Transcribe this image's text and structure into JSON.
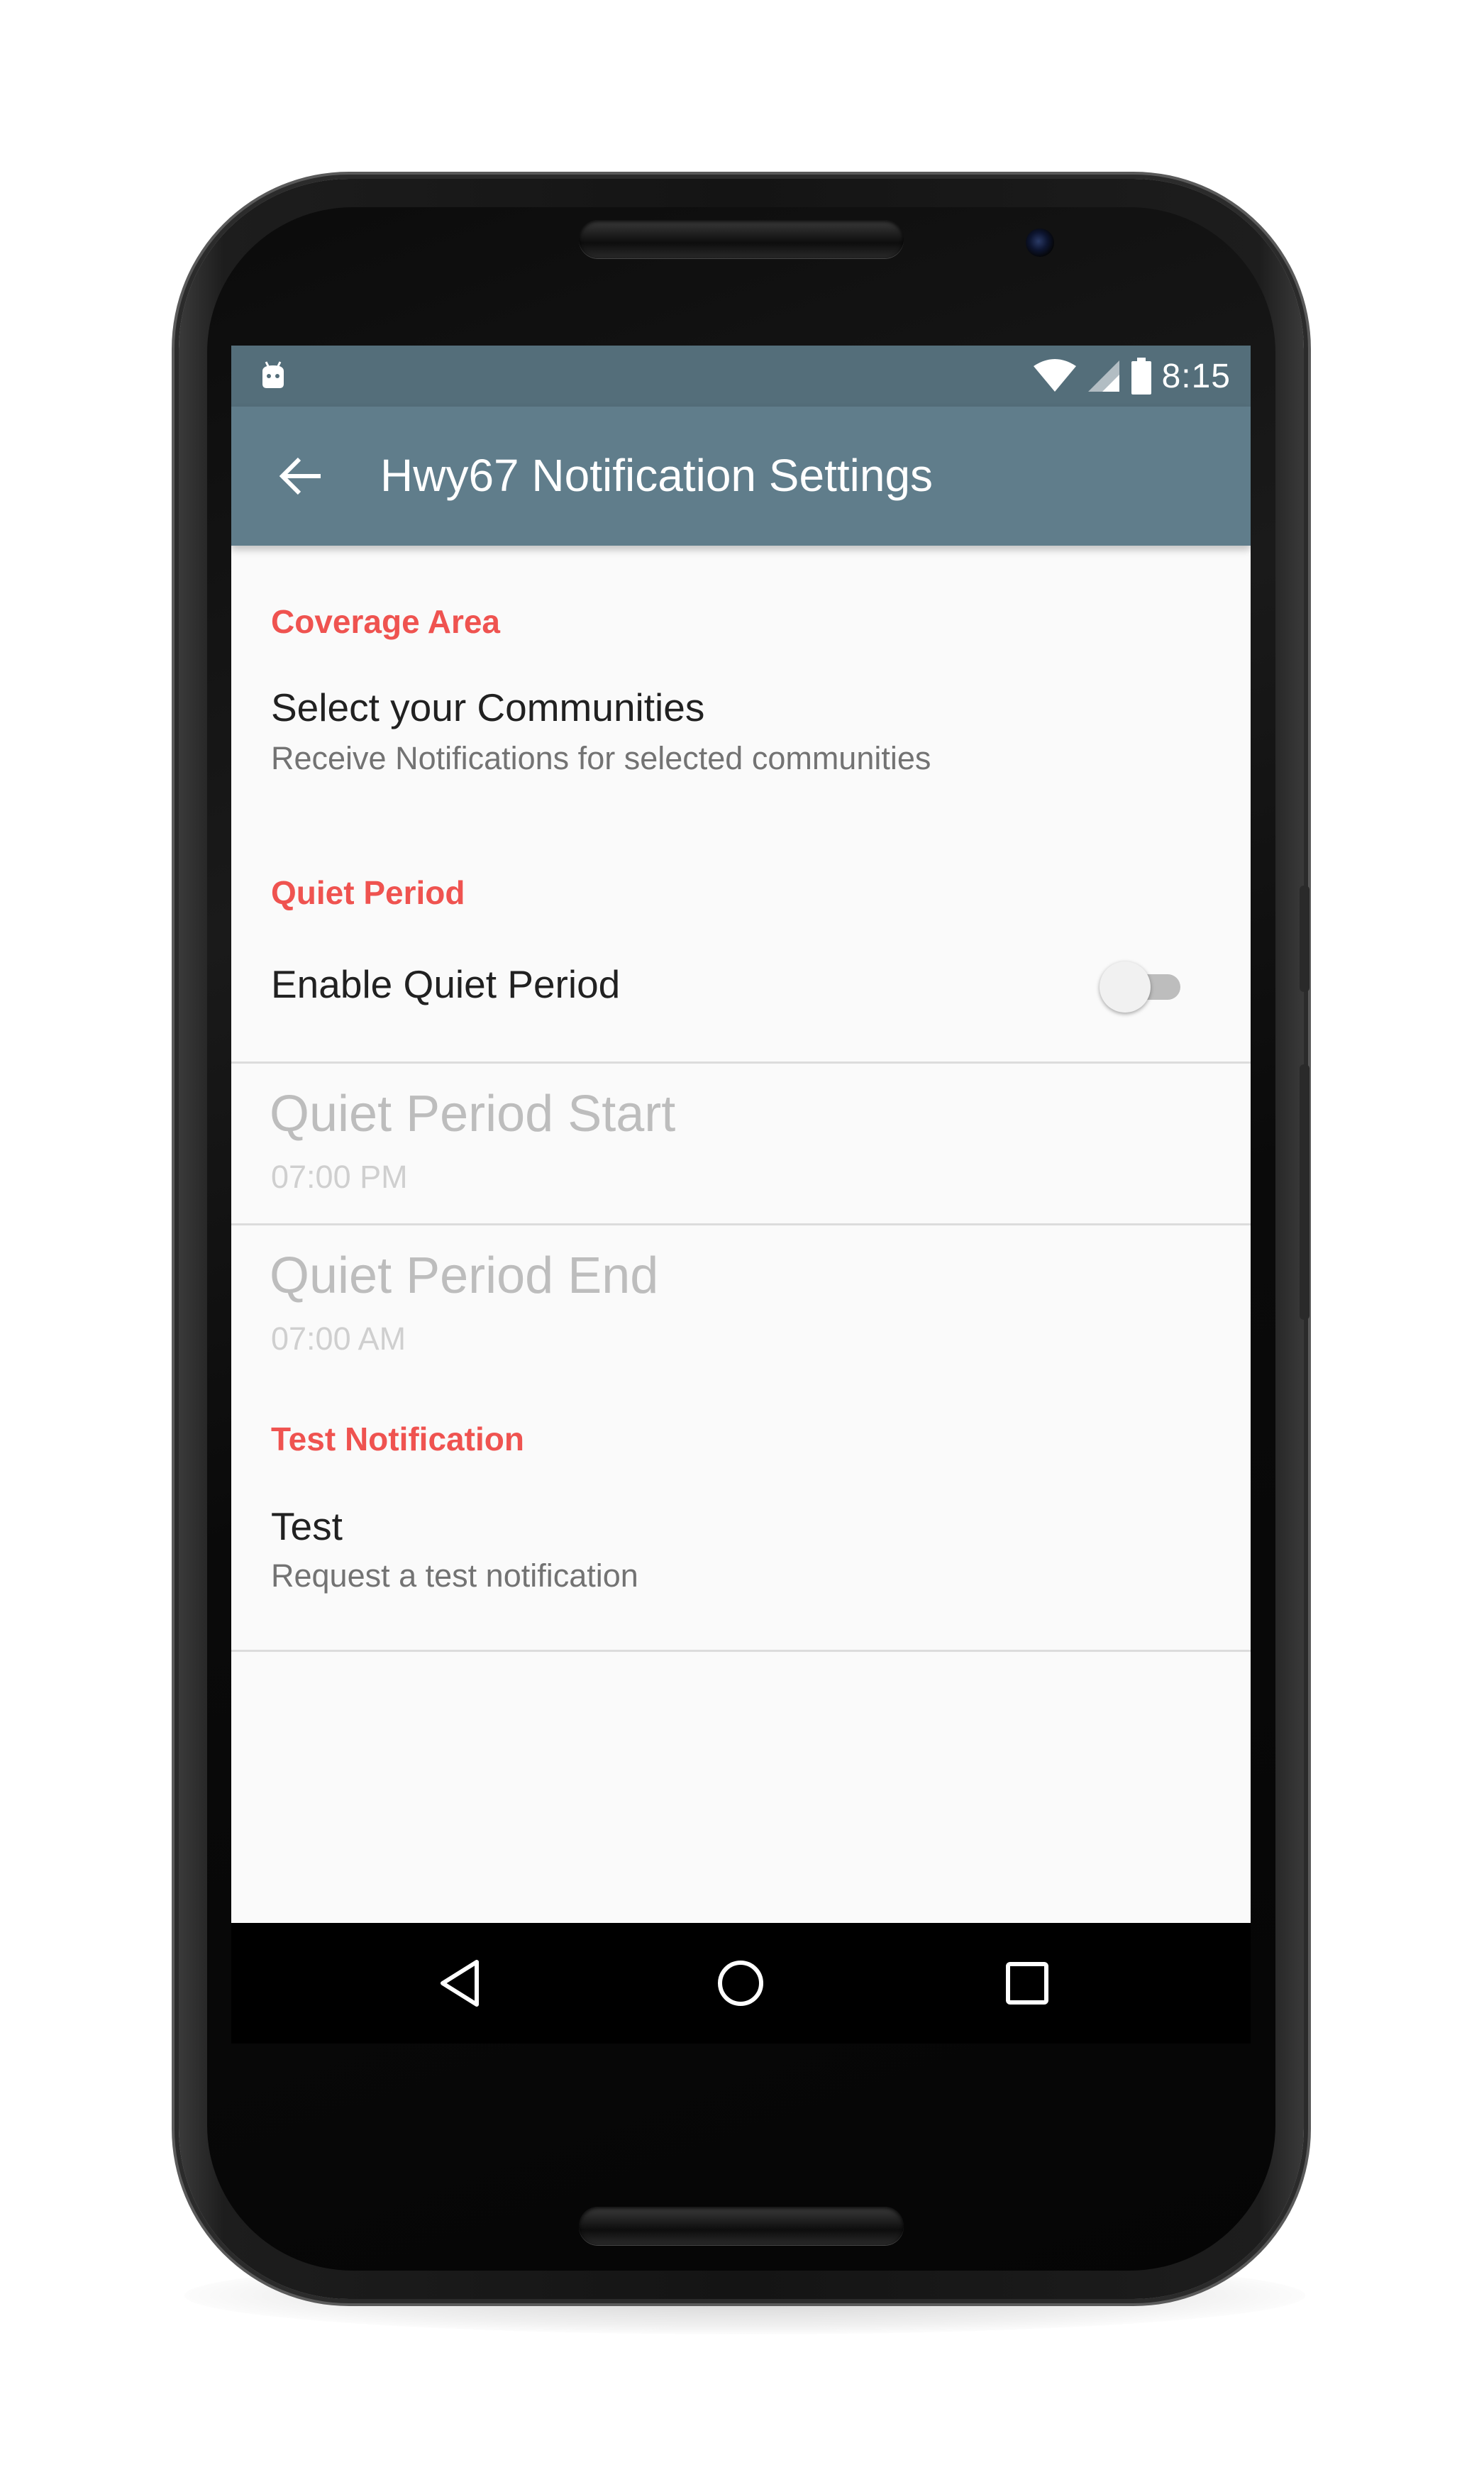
{
  "status_bar": {
    "time": "8:15",
    "icons": [
      "android-icon",
      "wifi-icon",
      "signal-icon",
      "battery-icon"
    ]
  },
  "app_bar": {
    "back_icon": "arrow-left-icon",
    "title": "Hwy67 Notification Settings"
  },
  "sections": {
    "coverage": {
      "header": "Coverage Area",
      "select_communities": {
        "title": "Select your Communities",
        "summary": "Receive Notifications for selected communities"
      }
    },
    "quiet": {
      "header": "Quiet Period",
      "enable": {
        "title": "Enable Quiet Period",
        "enabled": false
      },
      "start": {
        "title": "Quiet Period Start",
        "summary": "07:00 PM"
      },
      "end": {
        "title": "Quiet Period End",
        "summary": "07:00 AM"
      }
    },
    "test": {
      "header": "Test Notification",
      "item": {
        "title": "Test",
        "summary": "Request a test notification"
      }
    }
  },
  "nav_bar": {
    "icons": [
      "nav-back-icon",
      "nav-home-icon",
      "nav-recents-icon"
    ]
  },
  "colors": {
    "status_bar": "#546e7a",
    "app_bar": "#607d8b",
    "accent": "#ef5350",
    "background": "#fafafa"
  }
}
